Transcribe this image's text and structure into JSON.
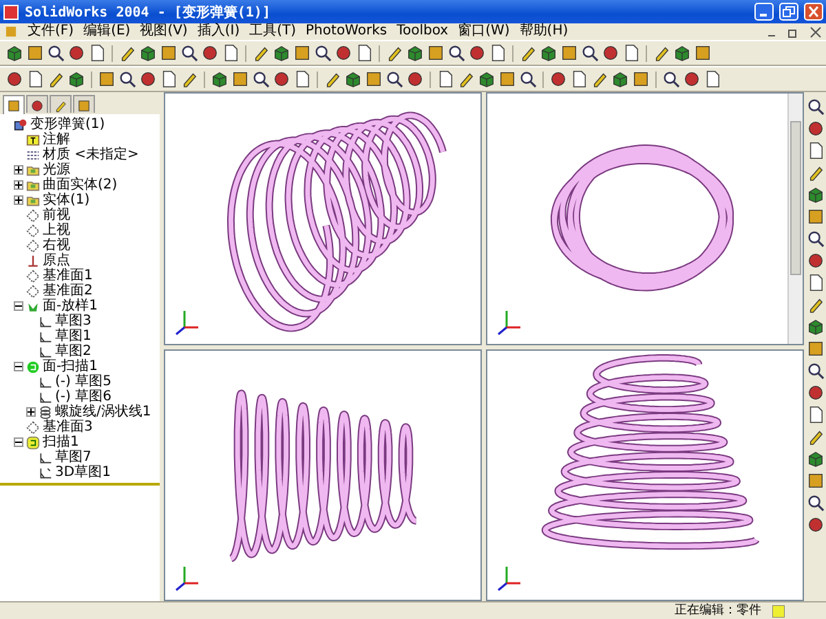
{
  "window": {
    "title": "SolidWorks 2004 - [变形弹簧(1)]"
  },
  "menu": [
    "文件(F)",
    "编辑(E)",
    "视图(V)",
    "插入(I)",
    "工具(T)",
    "PhotoWorks",
    "Toolbox",
    "窗口(W)",
    "帮助(H)"
  ],
  "panel_tabs": [
    {
      "selected": true
    },
    {
      "selected": false
    },
    {
      "selected": false
    },
    {
      "selected": false
    }
  ],
  "tree": {
    "label": "变形弹簧(1)",
    "kind": "part",
    "children": [
      {
        "label": "注解",
        "kind": "annotation"
      },
      {
        "label": "材质 <未指定>",
        "kind": "material"
      },
      {
        "label": "光源",
        "kind": "folder",
        "expanded": false
      },
      {
        "label": "曲面实体(2)",
        "kind": "folder",
        "expanded": false
      },
      {
        "label": "实体(1)",
        "kind": "folder",
        "expanded": false
      },
      {
        "label": "前视",
        "kind": "plane"
      },
      {
        "label": "上视",
        "kind": "plane"
      },
      {
        "label": "右视",
        "kind": "plane"
      },
      {
        "label": "原点",
        "kind": "origin"
      },
      {
        "label": "基准面1",
        "kind": "plane"
      },
      {
        "label": "基准面2",
        "kind": "plane"
      },
      {
        "label": "面-放样1",
        "kind": "loft",
        "expanded": true,
        "children": [
          {
            "label": "草图3",
            "kind": "sketch"
          },
          {
            "label": "草图1",
            "kind": "sketch"
          },
          {
            "label": "草图2",
            "kind": "sketch"
          }
        ]
      },
      {
        "label": "面-扫描1",
        "kind": "surface-sweep",
        "expanded": true,
        "children": [
          {
            "label": "(-) 草图5",
            "kind": "sketch"
          },
          {
            "label": "(-) 草图6",
            "kind": "sketch"
          },
          {
            "label": "螺旋线/涡状线1",
            "kind": "helix",
            "expanded": false
          }
        ]
      },
      {
        "label": "基准面3",
        "kind": "plane"
      },
      {
        "label": "扫描1",
        "kind": "sweep",
        "expanded": true,
        "children": [
          {
            "label": "草图7",
            "kind": "sketch"
          },
          {
            "label": "3D草图1",
            "kind": "sketch3d"
          }
        ]
      }
    ]
  },
  "viewports": [
    {
      "kind": "iso"
    },
    {
      "kind": "front"
    },
    {
      "kind": "side"
    },
    {
      "kind": "cone"
    }
  ],
  "status_bar": {
    "text": "正在编辑：零件"
  }
}
